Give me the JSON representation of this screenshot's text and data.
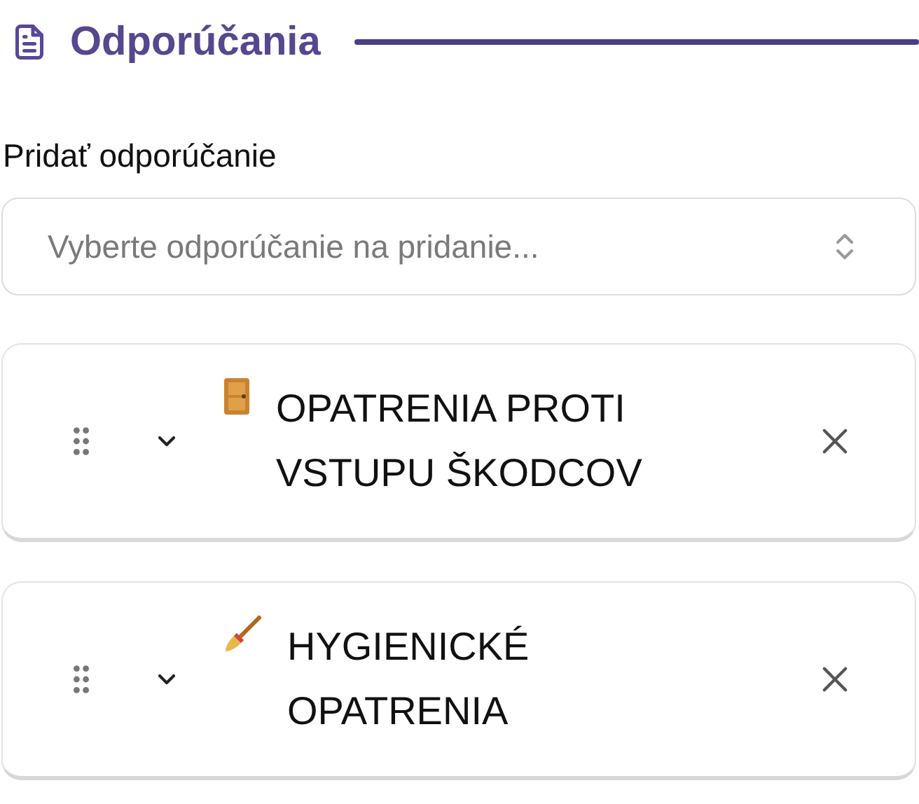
{
  "section": {
    "title": "Odporúčania"
  },
  "add_field": {
    "label": "Pridať odporúčanie",
    "placeholder": "Vyberte odporúčanie na pridanie..."
  },
  "recommendations": [
    {
      "title": "OPATRENIA PROTI VSTUPU ŠKODCOV",
      "expanded": false
    },
    {
      "title": "HYGIENICKÉ OPATRENIA",
      "expanded": false
    }
  ]
}
